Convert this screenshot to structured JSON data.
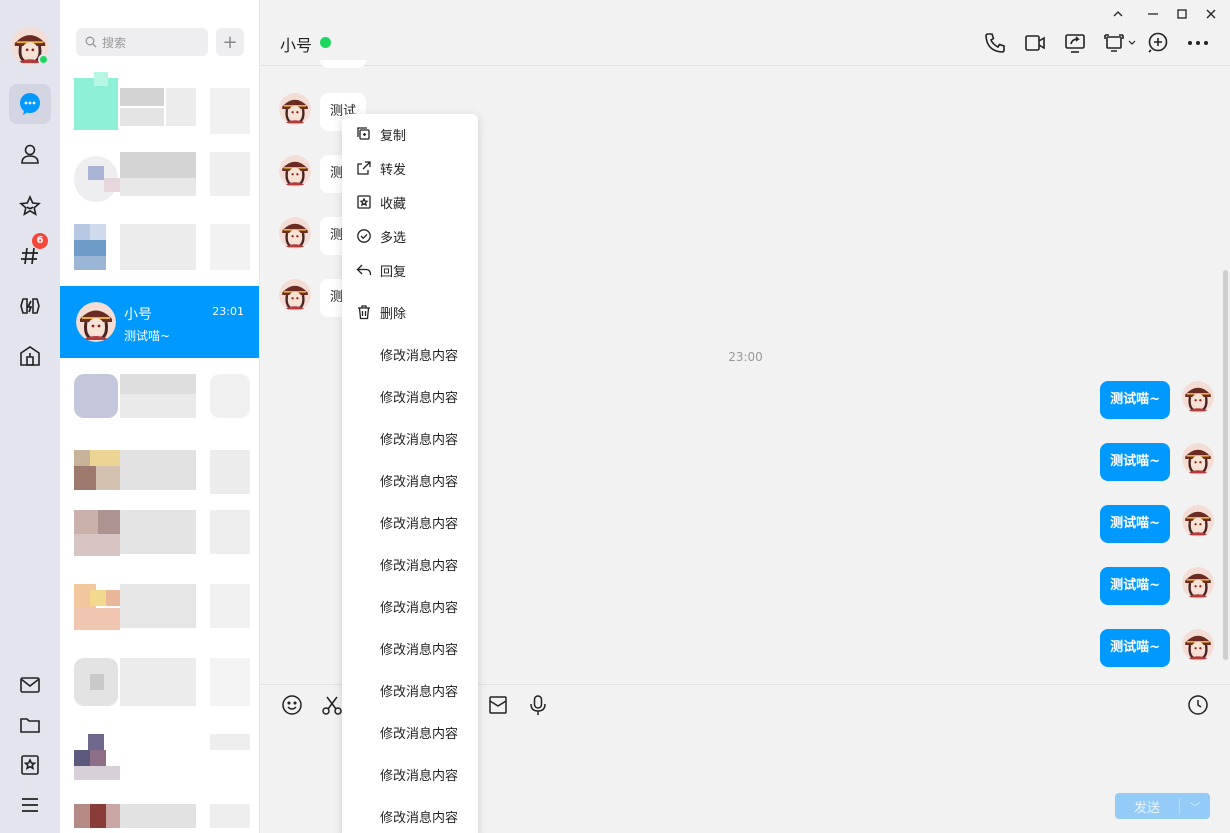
{
  "colors": {
    "accent": "#0099ff",
    "online": "#1ed760",
    "badge": "#f5463c"
  },
  "rail": {
    "items": [
      {
        "name": "chat-icon"
      },
      {
        "name": "contacts-icon"
      },
      {
        "name": "star-icon"
      },
      {
        "name": "channel-icon"
      },
      {
        "name": "game-icon"
      },
      {
        "name": "store-icon"
      }
    ],
    "channel_badge": "6",
    "bottom_items": [
      {
        "name": "mail-icon"
      },
      {
        "name": "folder-icon"
      },
      {
        "name": "favorites-icon"
      },
      {
        "name": "menu-icon"
      }
    ]
  },
  "list": {
    "search_placeholder": "搜索",
    "add_label": "+",
    "active": {
      "name": "小号",
      "time": "23:01",
      "preview": "测试喵~"
    }
  },
  "chat": {
    "title": "小号",
    "incoming": [
      "测试",
      "测",
      "测",
      "测"
    ],
    "time_separator": "23:00",
    "outgoing": [
      "测试喵~",
      "测试喵~",
      "测试喵~",
      "测试喵~",
      "测试喵~"
    ],
    "send_label": "发送",
    "send_arrow": "﹀"
  },
  "context_menu": {
    "items": [
      {
        "icon": "copy-icon",
        "label": "复制"
      },
      {
        "icon": "forward-icon",
        "label": "转发"
      },
      {
        "icon": "collect-icon",
        "label": "收藏"
      },
      {
        "icon": "multi-select-icon",
        "label": "多选"
      },
      {
        "icon": "reply-icon",
        "label": "回复"
      },
      {
        "icon": "delete-icon",
        "label": "删除"
      },
      {
        "label": "修改消息内容"
      },
      {
        "label": "修改消息内容"
      },
      {
        "label": "修改消息内容"
      },
      {
        "label": "修改消息内容"
      },
      {
        "label": "修改消息内容"
      },
      {
        "label": "修改消息内容"
      },
      {
        "label": "修改消息内容"
      },
      {
        "label": "修改消息内容"
      },
      {
        "label": "修改消息内容"
      },
      {
        "label": "修改消息内容"
      },
      {
        "label": "修改消息内容"
      },
      {
        "label": "修改消息内容"
      }
    ]
  }
}
